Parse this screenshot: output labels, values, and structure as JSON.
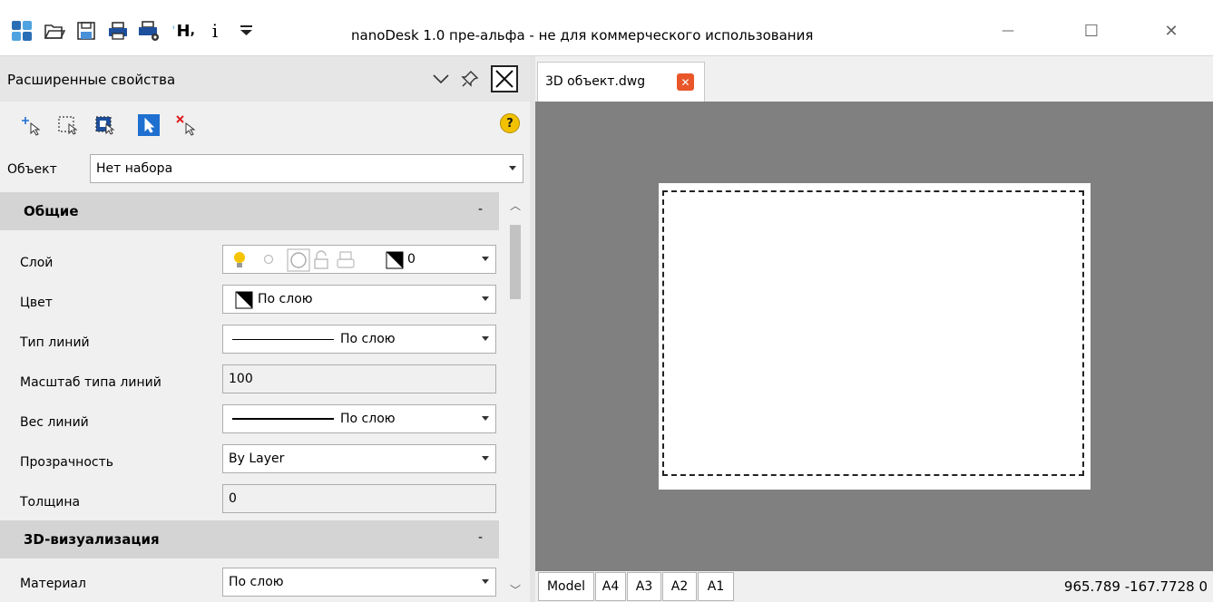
{
  "titlebar": {
    "title": "nanoDesk 1.0 пре-альфа - не для коммерческого использования",
    "text_style_glyph": "H",
    "info_glyph": "i",
    "qat_glyph": "⯆",
    "minimize_glyph": "—",
    "maximize_glyph": "☐",
    "close_glyph": "✕",
    "icons": [
      "app-logo-icon",
      "open-folder-icon",
      "save-icon",
      "print-icon",
      "print-settings-icon",
      "text-style-icon",
      "info-icon",
      "quick-access-customize-icon"
    ]
  },
  "panel": {
    "title": "Расширенные свойства",
    "help_glyph": "?",
    "object_label": "Объект",
    "object_value": "Нет набора",
    "categories": {
      "general": {
        "label": "Общие",
        "toggle": "-"
      },
      "viz3d": {
        "label": "3D-визуализация",
        "toggle": "-"
      }
    },
    "properties": {
      "layer": {
        "label": "Слой",
        "value": "0"
      },
      "color": {
        "label": "Цвет",
        "value": "По слою"
      },
      "linetype": {
        "label": "Тип линий",
        "value": "По слою"
      },
      "linetype_scale": {
        "label": "Масштаб типа линий",
        "value": "100"
      },
      "lineweight": {
        "label": "Вес линий",
        "value": "По слою"
      },
      "transparency": {
        "label": "Прозрачность",
        "value": "By Layer"
      },
      "thickness": {
        "label": "Толщина",
        "value": "0"
      },
      "material": {
        "label": "Материал",
        "value": "По слою"
      }
    },
    "scroll_up_glyph": "︿",
    "scroll_down_glyph": "﹀"
  },
  "document": {
    "tab_label": "3D объект.dwg",
    "tab_close_glyph": "✕"
  },
  "status": {
    "layout_tabs": [
      "Model",
      "A4",
      "A3",
      "A2",
      "A1"
    ],
    "coords": "965.789 -167.7728 0"
  },
  "colors": {
    "canvas_bg": "#808080",
    "panel_bg": "#f0f0f0",
    "category_bg": "#d4d4d4",
    "tab_close_bg": "#e8562a",
    "accent_blue": "#1e6fd0"
  }
}
